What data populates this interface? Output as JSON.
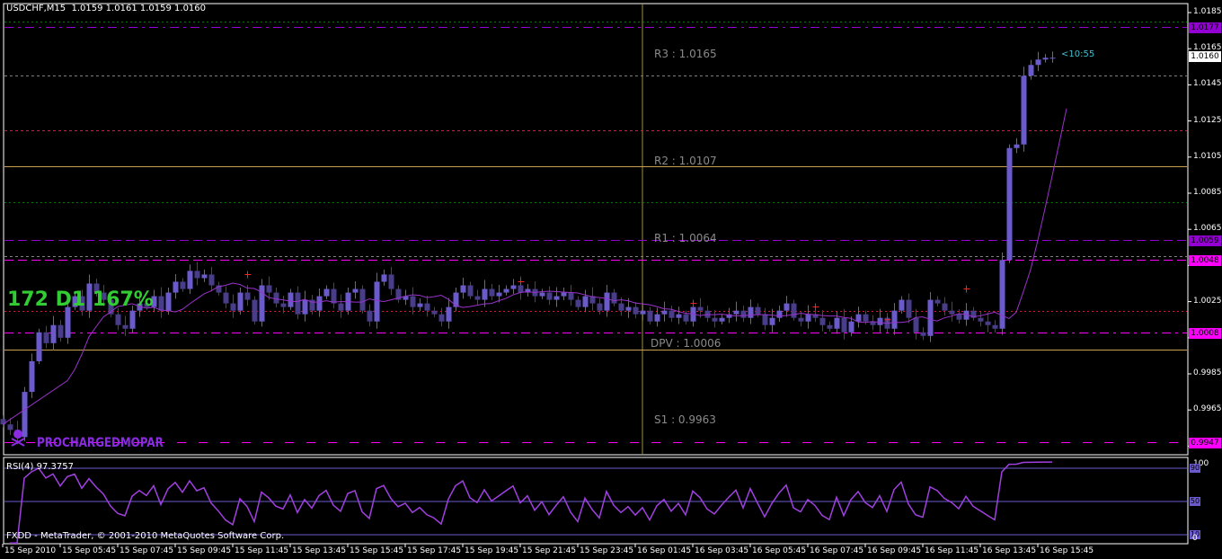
{
  "header": {
    "symbol": "USDCHF,M15",
    "ohlc": "1.0159 1.0161 1.0159 1.0160"
  },
  "overlay": {
    "stats": "172  D1 167%",
    "watermark": "PROCHARGEDMOPAR",
    "countdown": "<10:55"
  },
  "pivots": {
    "r3": "R3 : 1.0165",
    "r2": "R2 : 1.0107",
    "r1": "R1 : 1.0064",
    "dpv": "DPV : 1.0006",
    "s1": "S1 : 0.9963"
  },
  "rsi": {
    "label": "RSI(4) 97.3757",
    "period": 4,
    "axis": [
      "100",
      "90",
      "50",
      "10",
      "0"
    ]
  },
  "copyright": "FXDD - MetaTrader, © 2001-2010 MetaQuotes Software Corp.",
  "colors": {
    "bull": "#6a5acd",
    "bear": "#483d8b",
    "ma": "#9932cc",
    "rsi": "#a040e0",
    "pivot_line": "#c8a050",
    "green": "#32cd32",
    "magenta": "#ff00ff",
    "purple": "#9400d3"
  },
  "chart_data": {
    "type": "candlestick",
    "title": "USDCHF,M15",
    "ylim": [
      0.994,
      1.019
    ],
    "price_ticks": [
      "1.0185",
      "1.0165",
      "1.0145",
      "1.0125",
      "1.0105",
      "1.0085",
      "1.0065",
      "1.0045",
      "1.0025",
      "1.0005",
      "0.9985",
      "0.9965",
      "0.9945"
    ],
    "current_price": "1.0160",
    "time_labels": [
      "15 Sep 2010",
      "15 Sep 05:45",
      "15 Sep 07:45",
      "15 Sep 09:45",
      "15 Sep 11:45",
      "15 Sep 13:45",
      "15 Sep 15:45",
      "15 Sep 17:45",
      "15 Sep 19:45",
      "15 Sep 21:45",
      "15 Sep 23:45",
      "16 Sep 01:45",
      "16 Sep 03:45",
      "16 Sep 05:45",
      "16 Sep 07:45",
      "16 Sep 09:45",
      "16 Sep 11:45",
      "16 Sep 13:45",
      "16 Sep 15:45"
    ],
    "closes": [
      0.9957,
      0.9954,
      0.995,
      0.9975,
      0.9992,
      1.0008,
      1.0002,
      1.0012,
      1.0005,
      1.0022,
      1.0028,
      1.002,
      1.0035,
      1.003,
      1.0026,
      1.0018,
      1.0012,
      1.001,
      1.002,
      1.0024,
      1.0022,
      1.0028,
      1.002,
      1.003,
      1.0036,
      1.0032,
      1.0042,
      1.0038,
      1.004,
      1.0034,
      1.003,
      1.0024,
      1.002,
      1.003,
      1.0026,
      1.0014,
      1.0034,
      1.003,
      1.0024,
      1.0022,
      1.003,
      1.0018,
      1.0026,
      1.002,
      1.0028,
      1.0032,
      1.0024,
      1.002,
      1.003,
      1.0032,
      1.002,
      1.0014,
      1.0036,
      1.004,
      1.0032,
      1.0026,
      1.0028,
      1.0022,
      1.0024,
      1.002,
      1.0018,
      1.0014,
      1.0022,
      1.003,
      1.0034,
      1.0028,
      1.0026,
      1.0032,
      1.0028,
      1.003,
      1.0032,
      1.0034,
      1.003,
      1.0032,
      1.0028,
      1.003,
      1.0026,
      1.0028,
      1.003,
      1.0026,
      1.0022,
      1.0028,
      1.0024,
      1.002,
      1.003,
      1.0024,
      1.002,
      1.0022,
      1.0018,
      1.002,
      1.0014,
      1.0018,
      1.002,
      1.0016,
      1.0018,
      1.0014,
      1.0022,
      1.002,
      1.0016,
      1.0014,
      1.0016,
      1.0018,
      1.002,
      1.0016,
      1.0022,
      1.0018,
      1.0012,
      1.0016,
      1.002,
      1.0024,
      1.0016,
      1.0014,
      1.0018,
      1.0016,
      1.0012,
      1.001,
      1.0016,
      1.0008,
      1.0014,
      1.0018,
      1.0014,
      1.0012,
      1.0016,
      1.001,
      1.002,
      1.0026,
      1.0016,
      1.0008,
      1.0006,
      1.0026,
      1.0024,
      1.002,
      1.0018,
      1.0015,
      1.002,
      1.0016,
      1.0014,
      1.0012,
      1.001,
      1.0048,
      1.011,
      1.0112,
      1.015,
      1.0156,
      1.0159,
      1.016,
      1.016
    ],
    "ma_period": 8,
    "levels": [
      {
        "price": 1.018,
        "color": "#008000",
        "dash": "2,3",
        "tag": ""
      },
      {
        "price": 1.0177,
        "color": "#9400d3",
        "dash": "10,5,3,5",
        "tag": "1.0177"
      },
      {
        "price": 1.015,
        "color": "#808080",
        "dash": "3,3",
        "tag": ""
      },
      {
        "price": 1.012,
        "color": "#dc143c",
        "dash": "3,3",
        "tag": ""
      },
      {
        "price": 1.01,
        "color": "#c8a050",
        "dash": "",
        "tag": ""
      },
      {
        "price": 1.008,
        "color": "#008000",
        "dash": "2,3",
        "tag": ""
      },
      {
        "price": 1.0059,
        "color": "#9400d3",
        "dash": "10,5",
        "tag": "1.0059"
      },
      {
        "price": 1.005,
        "color": "#808080",
        "dash": "3,3",
        "tag": ""
      },
      {
        "price": 1.0048,
        "color": "#ff00ff",
        "dash": "10,5",
        "tag": "1.0048"
      },
      {
        "price": 1.002,
        "color": "#dc143c",
        "dash": "2,3",
        "tag": ""
      },
      {
        "price": 1.0008,
        "color": "#ff00ff",
        "dash": "10,5,3,5",
        "tag": "1.0008"
      },
      {
        "price": 0.99985,
        "color": "#c8a050",
        "dash": "",
        "tag": ""
      },
      {
        "price": 0.9947,
        "color": "#ff00ff",
        "dash": "10,14",
        "tag": "0.9947"
      }
    ],
    "markers": [
      {
        "bar": 34,
        "price": 1.004
      },
      {
        "bar": 72,
        "price": 1.0036
      },
      {
        "bar": 96,
        "price": 1.0024
      },
      {
        "bar": 113,
        "price": 1.0022
      },
      {
        "bar": 123,
        "price": 1.0015
      },
      {
        "bar": 134,
        "price": 1.0032
      }
    ]
  }
}
